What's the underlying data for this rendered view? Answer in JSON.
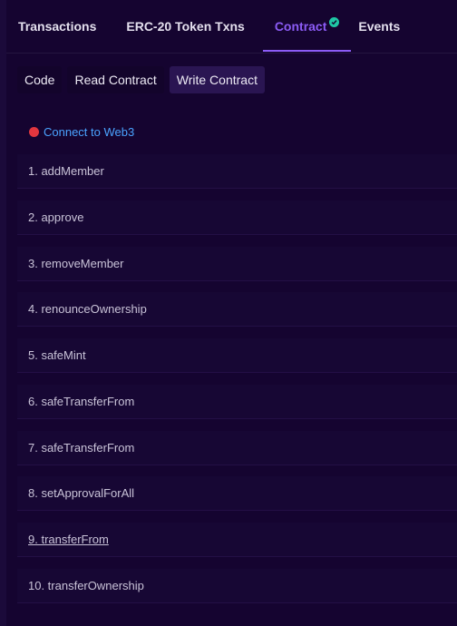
{
  "tabs": [
    {
      "label": "Transactions"
    },
    {
      "label": "ERC-20 Token Txns"
    },
    {
      "label": "Contract"
    },
    {
      "label": "Events"
    }
  ],
  "active_tab": "Contract",
  "subtabs": [
    {
      "label": "Code"
    },
    {
      "label": "Read Contract"
    },
    {
      "label": "Write Contract"
    }
  ],
  "active_subtab": "Write Contract",
  "connect": {
    "label": "Connect to Web3"
  },
  "functions": [
    {
      "label": "1. addMember"
    },
    {
      "label": "2. approve"
    },
    {
      "label": "3. removeMember"
    },
    {
      "label": "4. renounceOwnership"
    },
    {
      "label": "5. safeMint"
    },
    {
      "label": "6. safeTransferFrom"
    },
    {
      "label": "7. safeTransferFrom"
    },
    {
      "label": "8. setApprovalForAll"
    },
    {
      "label": "9. transferFrom"
    },
    {
      "label": "10. transferOwnership"
    }
  ],
  "colors": {
    "background": "#150430",
    "accent": "#8c5cf6",
    "verified": "#1fc7a5",
    "link": "#4aa3ff",
    "disconnected": "#e2373f"
  }
}
